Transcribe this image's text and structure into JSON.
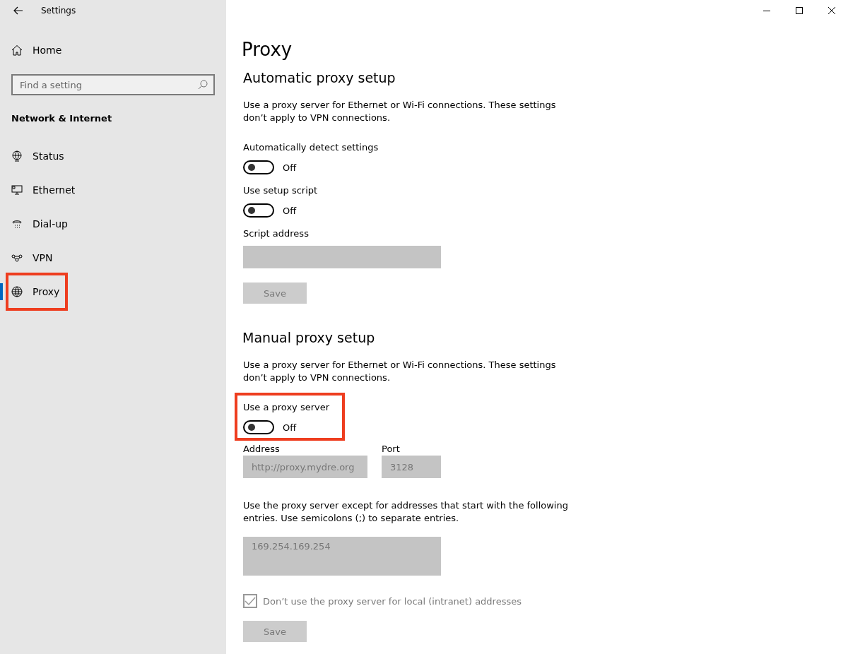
{
  "window": {
    "title": "Settings"
  },
  "sidebar": {
    "home": "Home",
    "search": {
      "placeholder": "Find a setting"
    },
    "section": "Network & Internet",
    "items": [
      {
        "label": "Status",
        "selected": false,
        "highlighted": false
      },
      {
        "label": "Ethernet",
        "selected": false,
        "highlighted": false
      },
      {
        "label": "Dial-up",
        "selected": false,
        "highlighted": false
      },
      {
        "label": "VPN",
        "selected": false,
        "highlighted": false
      },
      {
        "label": "Proxy",
        "selected": true,
        "highlighted": true
      }
    ]
  },
  "page": {
    "title": "Proxy",
    "automatic": {
      "heading": "Automatic proxy setup",
      "description": "Use a proxy server for Ethernet or Wi-Fi connections. These settings don’t apply to VPN connections.",
      "toggles": [
        {
          "label": "Automatically detect settings",
          "on": false,
          "state": "Off",
          "highlighted": false
        },
        {
          "label": "Use setup script",
          "on": false,
          "state": "Off",
          "highlighted": false
        }
      ],
      "script_address": {
        "label": "Script address",
        "disabled": true
      },
      "save": {
        "label": "Save",
        "disabled": true
      }
    },
    "manual": {
      "heading": "Manual proxy setup",
      "description": "Use a proxy server for Ethernet or Wi-Fi connections. These settings don’t apply to VPN connections.",
      "toggle": {
        "label": "Use a proxy server",
        "on": false,
        "state": "Off",
        "highlighted": true
      },
      "address": {
        "label": "Address",
        "value": "http://proxy.mydre.org",
        "disabled": true
      },
      "port": {
        "label": "Port",
        "value": "3128",
        "disabled": true
      },
      "exceptions": {
        "description": "Use the proxy server except for addresses that start with the following entries. Use semicolons (;) to separate entries.",
        "value": "169.254.169.254",
        "disabled": true
      },
      "local_checkbox": {
        "label": "Don’t use the proxy server for local (intranet) addresses",
        "checked": true,
        "disabled": true
      },
      "save": {
        "label": "Save",
        "disabled": true
      }
    }
  }
}
